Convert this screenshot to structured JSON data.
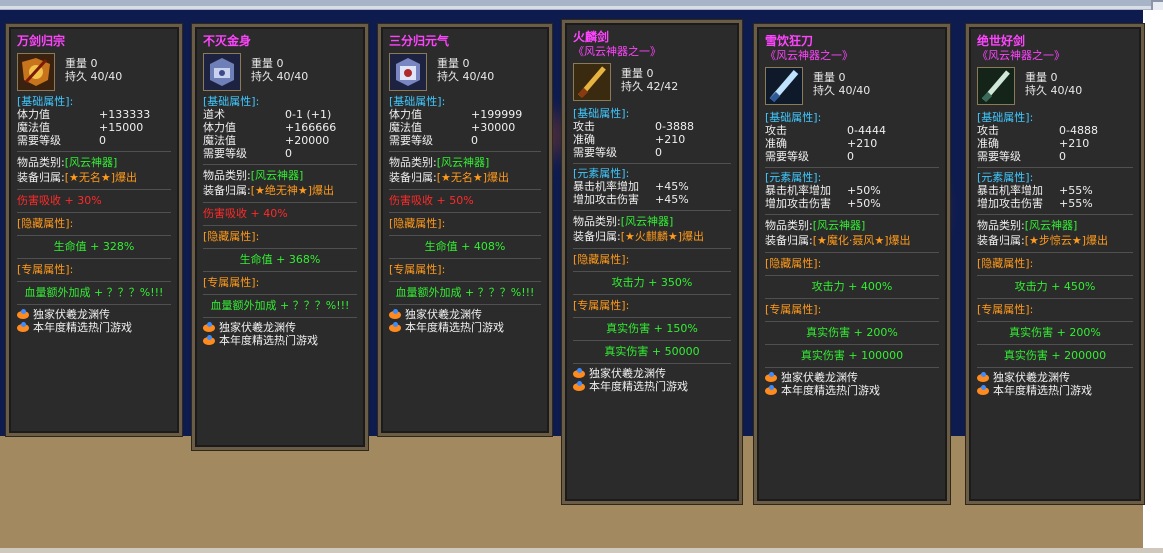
{
  "colors": {
    "title": "#ff44ff",
    "section": "#40c8ff",
    "set": "#33ee33",
    "owner": "#ff9a1a",
    "lifesteal": "#ff2a2a",
    "attr": "#33ee33",
    "element": "#34f0d8"
  },
  "labels": {
    "weight": "重量",
    "durability": "持久",
    "base_attr": "[基础属性]:",
    "element_attr": "[元素属性]:",
    "hidden_attr": "[隐藏属性]:",
    "exclusive_attr": "[专属属性]:",
    "item_class": "物品类别:",
    "belongs": "装备归属:"
  },
  "cards": [
    {
      "title": "万剑归宗",
      "weight": "0",
      "dur": "40/40",
      "base": [
        [
          "体力值",
          "+133333"
        ],
        [
          "魔法值",
          "+15000"
        ],
        [
          "需要等级",
          "0"
        ]
      ],
      "cat": "[风云神器]",
      "owner": "[★无名★]爆出",
      "lifesteal": "伤害吸收 + 30%",
      "hidden": "生命值 + 328%",
      "exclusive": "血量额外加成 + ？？？%!!!",
      "promo": [
        "独家伏羲龙渊传",
        "本年度精选热门游戏"
      ]
    },
    {
      "title": "不灭金身",
      "weight": "0",
      "dur": "40/40",
      "base": [
        [
          "道术",
          "0-1 (+1)"
        ],
        [
          "体力值",
          "+166666"
        ],
        [
          "魔法值",
          "+20000"
        ],
        [
          "需要等级",
          "0"
        ]
      ],
      "cat": "[风云神器]",
      "owner": "[★绝无神★]爆出",
      "lifesteal": "伤害吸收 + 40%",
      "hidden": "生命值 + 368%",
      "exclusive": "血量额外加成 + ？？？%!!!",
      "promo": [
        "独家伏羲龙渊传",
        "本年度精选热门游戏"
      ]
    },
    {
      "title": "三分归元气",
      "weight": "0",
      "dur": "40/40",
      "base": [
        [
          "体力值",
          "+199999"
        ],
        [
          "魔法值",
          "+30000"
        ],
        [
          "需要等级",
          "0"
        ]
      ],
      "cat": "[风云神器]",
      "owner": "[★无名★]爆出",
      "lifesteal": "伤害吸收 + 50%",
      "hidden": "生命值 + 408%",
      "exclusive": "血量额外加成 + ？？？%!!!",
      "promo": [
        "独家伏羲龙渊传",
        "本年度精选热门游戏"
      ]
    },
    {
      "title": "火麟剑",
      "sub": "《风云神器之一》",
      "weight": "0",
      "dur": "42/42",
      "base": [
        [
          "攻击",
          "0-3888"
        ],
        [
          "准确",
          "+210"
        ],
        [
          "需要等级",
          "0"
        ]
      ],
      "elem": [
        [
          "暴击机率增加",
          "+45%"
        ],
        [
          "增加攻击伤害",
          "+45%"
        ]
      ],
      "cat": "[风云神器]",
      "owner": "[★火麒麟★]爆出",
      "hidden": "攻击力 + 350%",
      "ex1": "真实伤害 + 150%",
      "ex2": "真实伤害 + 50000",
      "promo": [
        "独家伏羲龙渊传",
        "本年度精选热门游戏"
      ]
    },
    {
      "title": "雪饮狂刀",
      "sub": "《风云神器之一》",
      "weight": "0",
      "dur": "40/40",
      "base": [
        [
          "攻击",
          "0-4444"
        ],
        [
          "准确",
          "+210"
        ],
        [
          "需要等级",
          "0"
        ]
      ],
      "elem": [
        [
          "暴击机率增加",
          "+50%"
        ],
        [
          "增加攻击伤害",
          "+50%"
        ]
      ],
      "cat": "[风云神器]",
      "owner": "[★魔化·聂风★]爆出",
      "hidden": "攻击力 + 400%",
      "ex1": "真实伤害 + 200%",
      "ex2": "真实伤害 + 100000",
      "promo": [
        "独家伏羲龙渊传",
        "本年度精选热门游戏"
      ]
    },
    {
      "title": "绝世好剑",
      "sub": "《风云神器之一》",
      "weight": "0",
      "dur": "40/40",
      "base": [
        [
          "攻击",
          "0-4888"
        ],
        [
          "准确",
          "+210"
        ],
        [
          "需要等级",
          "0"
        ]
      ],
      "elem": [
        [
          "暴击机率增加",
          "+55%"
        ],
        [
          "增加攻击伤害",
          "+55%"
        ]
      ],
      "cat": "[风云神器]",
      "owner": "[★步惊云★]爆出",
      "hidden": "攻击力 + 450%",
      "ex1": "真实伤害 + 200%",
      "ex2": "真实伤害 + 200000",
      "promo": [
        "独家伏羲龙渊传",
        "本年度精选热门游戏"
      ]
    }
  ]
}
